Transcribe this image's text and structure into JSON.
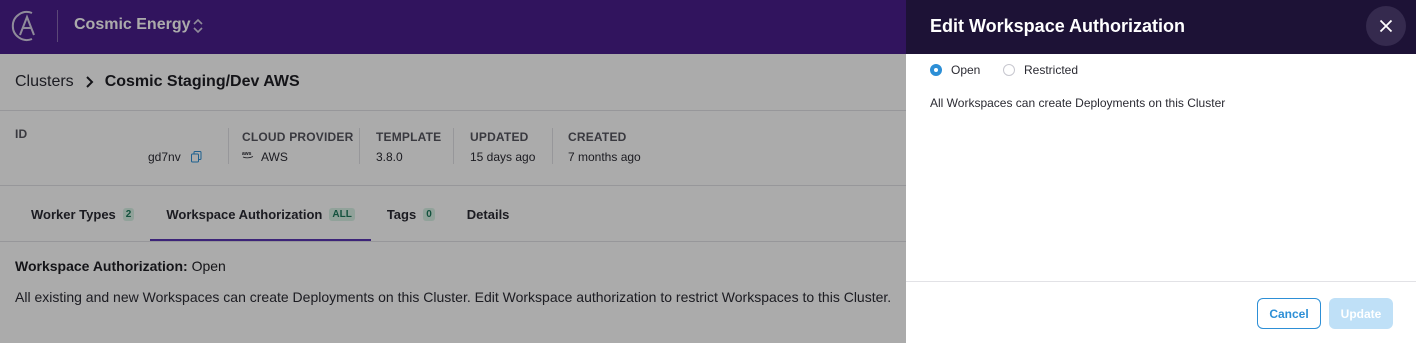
{
  "colors": {
    "topbar": "#4a1e8c",
    "drawer_header": "#1d1236",
    "accent": "#2d8fd6",
    "tab_active_underline": "#5a36b3",
    "badge_green": "#1d7a5c"
  },
  "topbar": {
    "org_name": "Cosmic Energy",
    "logo_icon": "astronomer-logo",
    "switch_icon": "chevron-up-down-icon"
  },
  "breadcrumb": {
    "root": "Clusters",
    "current": "Cosmic Staging/Dev AWS"
  },
  "meta": {
    "id_label": "ID",
    "id_value_visible": "gd7nv",
    "provider_label": "CLOUD PROVIDER",
    "provider_value": "AWS",
    "template_label": "TEMPLATE",
    "template_value": "3.8.0",
    "updated_label": "UPDATED",
    "updated_value": "15 days ago",
    "created_label": "CREATED",
    "created_value": "7 months ago"
  },
  "tabs": [
    {
      "label": "Worker Types",
      "badge": "2"
    },
    {
      "label": "Workspace Authorization",
      "badge": "ALL"
    },
    {
      "label": "Tags",
      "badge": "0"
    },
    {
      "label": "Details",
      "badge": ""
    }
  ],
  "content": {
    "title_bold": "Workspace Authorization:",
    "title_value": "Open",
    "description": "All existing and new Workspaces can create Deployments on this Cluster. Edit Workspace authorization to restrict Workspaces to this Cluster."
  },
  "drawer": {
    "title": "Edit Workspace Authorization",
    "options": [
      {
        "label": "Open",
        "checked": true
      },
      {
        "label": "Restricted",
        "checked": false
      }
    ],
    "description": "All Workspaces can create Deployments on this Cluster",
    "cancel_label": "Cancel",
    "update_label": "Update"
  }
}
